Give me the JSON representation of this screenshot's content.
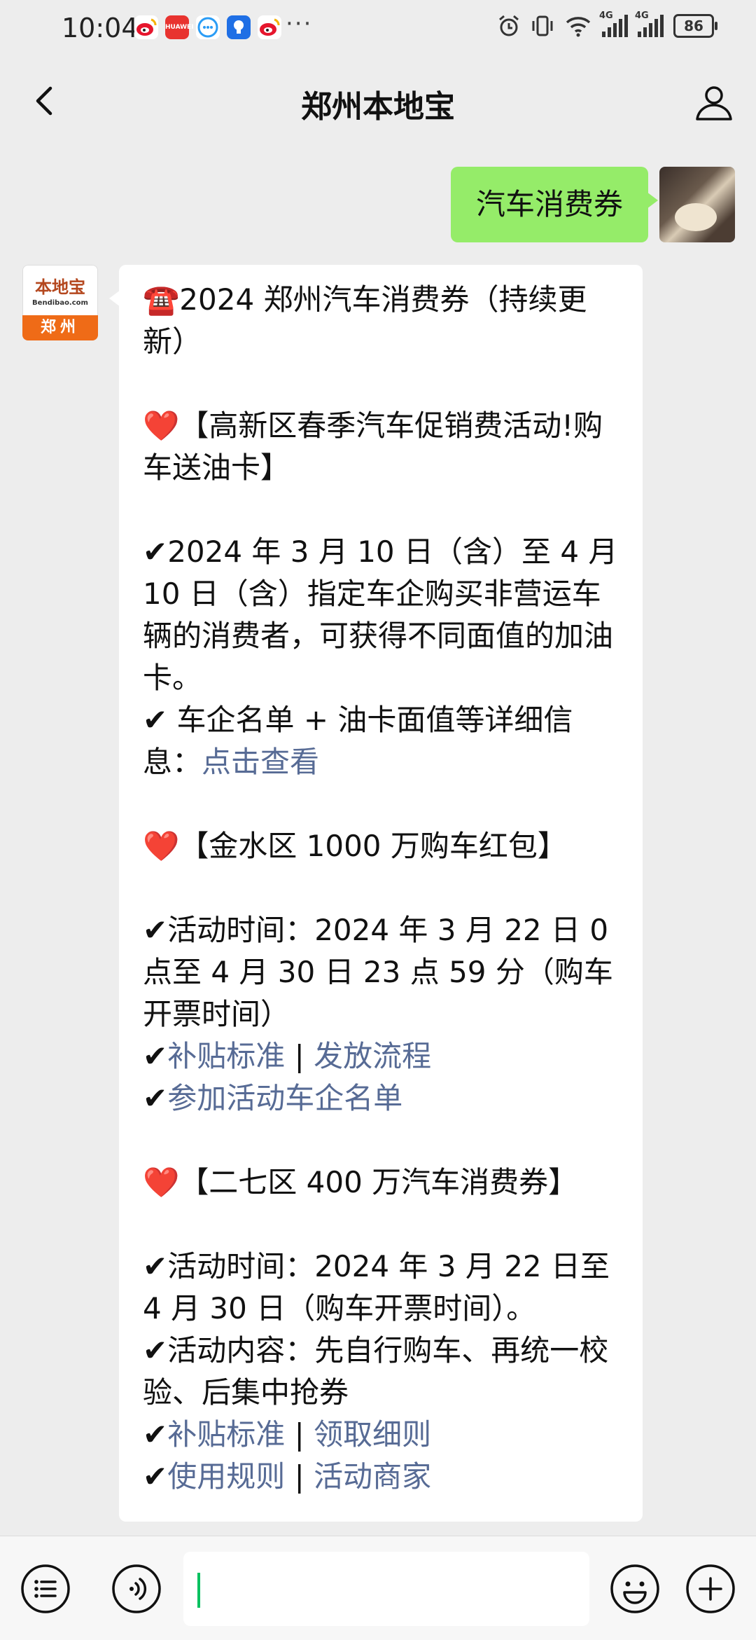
{
  "status_bar": {
    "time": "10:04",
    "app_icons": [
      {
        "name": "weibo-icon",
        "color": "#f6b20a"
      },
      {
        "name": "huawei-app-icon",
        "color": "#e8332f"
      },
      {
        "name": "chat-app-icon",
        "color": "#2a9cf5"
      },
      {
        "name": "bulb-app-icon",
        "color": "#1f6fe5"
      },
      {
        "name": "weibo-icon",
        "color": "#f6b20a"
      }
    ],
    "more": "···",
    "signal_1_label": "4G",
    "signal_2_label": "4G",
    "battery": "86"
  },
  "header": {
    "title": "郑州本地宝"
  },
  "outgoing_message": {
    "text": "汽车消费券"
  },
  "bot_avatar": {
    "name": "本地宝",
    "url": "Bendibao.com",
    "city": "郑州"
  },
  "reply": {
    "title": "☎️2024 郑州汽车消费券（持续更新）",
    "s1": {
      "heading": "❤️【高新区春季汽车促销费活动!购车送油卡】",
      "p1": "✔2024 年 3 月 10 日（含）至 4 月 10 日（含）指定车企购买非营运车辆的消费者，可获得不同面值的加油卡。",
      "p2_prefix": "✔ 车企名单 + 油卡面值等详细信息：",
      "p2_link": "点击查看"
    },
    "s2": {
      "heading": "❤️【金水区 1000 万购车红包】",
      "p1": "✔活动时间：2024 年 3 月 22 日 0 点至 4 月 30 日 23 点 59 分（购车开票时间）",
      "link_a": "补贴标准",
      "sep": " | ",
      "link_b": "发放流程",
      "link_c": "参加活动车企名单"
    },
    "s3": {
      "heading": "❤️【二七区 400 万汽车消费券】",
      "p1": "✔活动时间：2024 年 3 月 22 日至 4 月 30 日（购车开票时间）。",
      "p2": "✔活动内容：先自行购车、再统一校验、后集中抢券",
      "link_a": "补贴标准",
      "link_b": "领取细则",
      "link_c": "使用规则",
      "link_d": "活动商家",
      "sep": " | "
    },
    "check": "✔"
  },
  "colors": {
    "outgoing_bubble": "#95ec69",
    "link": "#576b95",
    "background": "#ededed",
    "caret": "#07c160"
  }
}
